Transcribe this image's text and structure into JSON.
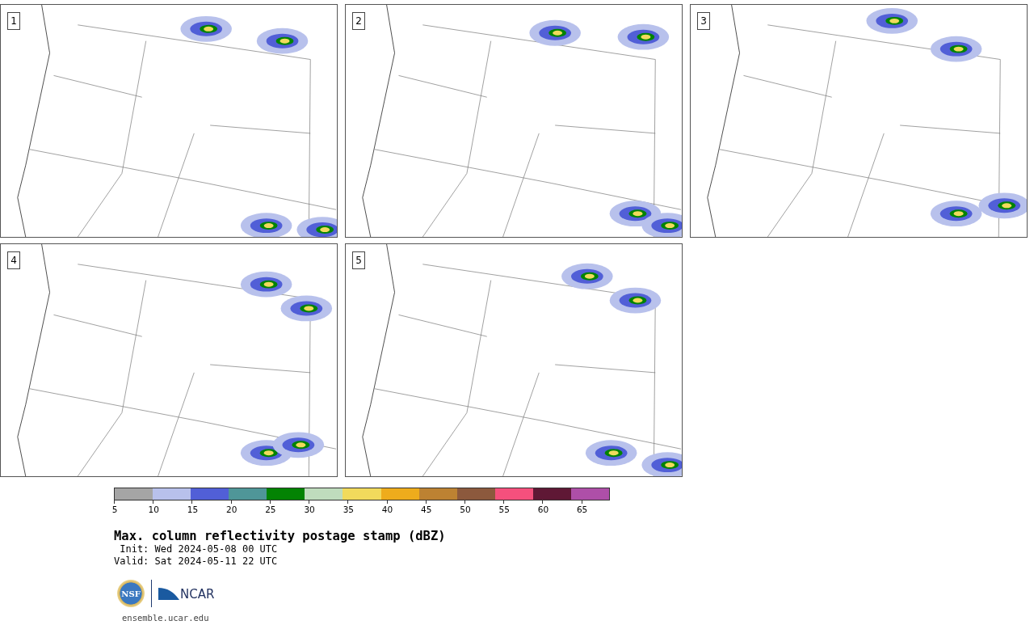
{
  "panels": [
    {
      "label": "1"
    },
    {
      "label": "2"
    },
    {
      "label": "3"
    },
    {
      "label": "4"
    },
    {
      "label": "5"
    }
  ],
  "colorbar": {
    "bins": [
      {
        "color": "#a5a5a5"
      },
      {
        "color": "#b8c1ec"
      },
      {
        "color": "#515fd7"
      },
      {
        "color": "#4f9698"
      },
      {
        "color": "#038303"
      },
      {
        "color": "#bfdcbd"
      },
      {
        "color": "#f1da5c"
      },
      {
        "color": "#eeac1c"
      },
      {
        "color": "#bd8232"
      },
      {
        "color": "#8c593d"
      },
      {
        "color": "#f5507d"
      },
      {
        "color": "#5f1835"
      },
      {
        "color": "#ae4fa8"
      }
    ],
    "ticks": [
      "5",
      "10",
      "15",
      "20",
      "25",
      "30",
      "35",
      "40",
      "45",
      "50",
      "55",
      "60",
      "65"
    ]
  },
  "title": "Max. column reflectivity postage stamp (dBZ)",
  "init": " Init: Wed 2024-05-08 00 UTC",
  "valid": "Valid: Sat 2024-05-11 22 UTC",
  "logo": {
    "seal": "NSF",
    "name": "NCAR"
  },
  "url": "ensemble.ucar.edu"
}
